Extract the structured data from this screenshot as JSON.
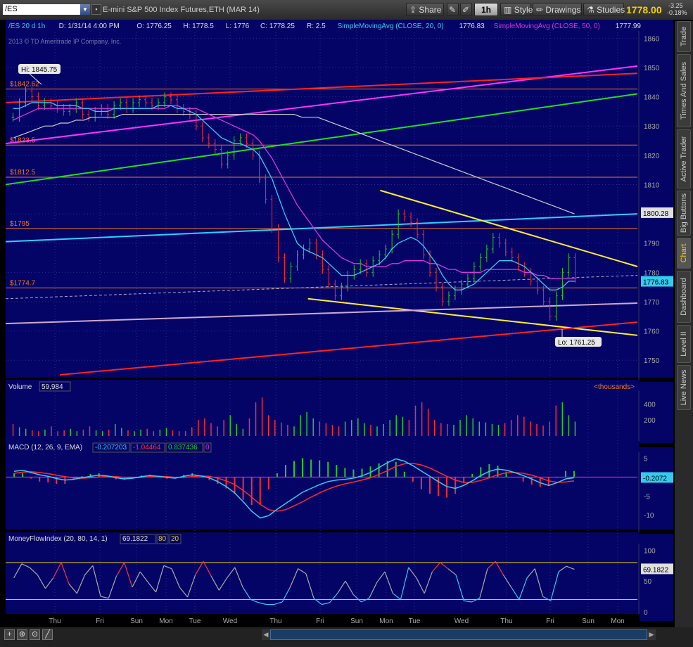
{
  "toolbar": {
    "symbol": "/ES",
    "instrument_desc": "E-mini S&P 500 Index Futures,ETH (MAR 14)",
    "share": "Share",
    "timeframe": "1h",
    "style": "Style",
    "drawings": "Drawings",
    "studies": "Studies",
    "last_price": "1778.00",
    "change_abs": "-3.25",
    "change_pct": "-0.18%"
  },
  "side_tabs": [
    "Trade",
    "Times And Sales",
    "Active Trader",
    "Big Buttons",
    "Chart",
    "Dashboard",
    "Level II",
    "Live News"
  ],
  "active_side_tab": "Chart",
  "colors": {
    "background": "#040466",
    "bull_bar": "#22cc22",
    "bear_bar": "#ff2a2a",
    "sma20": "#33ccee",
    "sma50": "#dd33dd",
    "sma200": "#cccccc",
    "trend_magenta": "#ff33ff",
    "trend_red": "#ff2222",
    "trend_green": "#22dd22",
    "trend_cyan": "#33ccff",
    "trend_yellow": "#ffee33",
    "trend_lavender": "#ccaacc",
    "level_orange": "#ee7722",
    "macd_value": "#33ccee",
    "macd_avg": "#ff2a2a",
    "mfi_line": "#aaaaaa",
    "mfi_band": "#ddcc22"
  },
  "chart_data": [
    {
      "panel": "price",
      "type": "line",
      "header": {
        "symbol_period": "/ES 20 d 1h",
        "date": "D: 1/31/14 4:00 PM",
        "open": "O: 1776.25",
        "high": "H: 1778.5",
        "low": "L: 1776",
        "close": "C: 1778.25",
        "range": "R: 2.5",
        "sma20_label": "SimpleMovingAvg (CLOSE, 20, 0)",
        "sma20_value": "1776.83",
        "sma50_label": "SimpleMovingAvg (CLOSE, 50, 0)",
        "sma50_value": "1777.99"
      },
      "watermark": "2013 © TD Ameritrade IP Company, Inc.",
      "ylim": [
        1745,
        1862
      ],
      "yticks": [
        1750,
        1760,
        1770,
        1780,
        1790,
        1800,
        1810,
        1820,
        1830,
        1840,
        1850,
        1860
      ],
      "xlim": [
        0,
        14
      ],
      "xticks": [
        {
          "x": 1.0,
          "label": "Thu"
        },
        {
          "x": 2.0,
          "label": "Fri"
        },
        {
          "x": 3.0,
          "label": "Sun"
        },
        {
          "x": 4.0,
          "label": "Mon"
        },
        {
          "x": 5.0,
          "label": "Tue"
        },
        {
          "x": 6.0,
          "label": "Wed"
        },
        {
          "x": 7.0,
          "label": "Thu"
        },
        {
          "x": 8.0,
          "label": "Fri"
        },
        {
          "x": 9.0,
          "label": "Sun"
        },
        {
          "x": 10.0,
          "label": "Mon"
        },
        {
          "x": 11.0,
          "label": "Tue"
        },
        {
          "x": 12.0,
          "label": "Wed"
        },
        {
          "x": 13.0,
          "label": "Thu"
        },
        {
          "x": 14.0,
          "label": "Fri"
        }
      ],
      "xtick_labels_display": [
        "Thu",
        "Fri",
        "Sun",
        "Mon",
        "Tue",
        "Wed",
        "Thu",
        "Fri",
        "Sun",
        "Mon",
        "Tue",
        "Wed",
        "Thu",
        "Fri",
        "Sun",
        "Mon"
      ],
      "close_series": [
        1833,
        1838,
        1842,
        1840,
        1837,
        1838,
        1837,
        1836,
        1835,
        1836,
        1838,
        1834,
        1833,
        1835,
        1836,
        1834,
        1837,
        1838,
        1836,
        1838,
        1839,
        1838,
        1837,
        1838,
        1840,
        1839,
        1836,
        1835,
        1834,
        1830,
        1826,
        1824,
        1822,
        1817,
        1820,
        1825,
        1826,
        1824,
        1820,
        1812,
        1805,
        1795,
        1785,
        1778,
        1782,
        1786,
        1788,
        1790,
        1786,
        1781,
        1776,
        1772,
        1775,
        1779,
        1781,
        1783,
        1780,
        1784,
        1786,
        1788,
        1793,
        1800,
        1799,
        1797,
        1793,
        1786,
        1780,
        1775,
        1770,
        1772,
        1774,
        1776,
        1778,
        1782,
        1785,
        1788,
        1792,
        1790,
        1787,
        1785,
        1782,
        1780,
        1777,
        1774,
        1770,
        1765,
        1772,
        1780,
        1785,
        1778
      ],
      "sma20_series": [
        1836,
        1836,
        1837,
        1838,
        1838,
        1838,
        1838,
        1837,
        1837,
        1837,
        1837,
        1836,
        1836,
        1835,
        1835,
        1835,
        1836,
        1836,
        1836,
        1836,
        1836,
        1836,
        1836,
        1837,
        1837,
        1837,
        1836,
        1836,
        1835,
        1834,
        1832,
        1830,
        1828,
        1826,
        1825,
        1824,
        1824,
        1823,
        1822,
        1820,
        1816,
        1812,
        1806,
        1800,
        1795,
        1790,
        1788,
        1787,
        1786,
        1785,
        1783,
        1781,
        1779,
        1779,
        1779,
        1780,
        1781,
        1782,
        1783,
        1785,
        1788,
        1790,
        1791,
        1792,
        1791,
        1789,
        1786,
        1783,
        1779,
        1776,
        1774,
        1774,
        1775,
        1776,
        1778,
        1780,
        1782,
        1784,
        1784,
        1784,
        1783,
        1782,
        1780,
        1778,
        1776,
        1774,
        1774,
        1775,
        1777,
        1777
      ],
      "sma50_series": [
        1832,
        1833,
        1834,
        1835,
        1836,
        1836,
        1836,
        1836,
        1836,
        1836,
        1836,
        1836,
        1836,
        1836,
        1836,
        1836,
        1836,
        1836,
        1836,
        1836,
        1836,
        1836,
        1836,
        1836,
        1836,
        1837,
        1837,
        1836,
        1836,
        1836,
        1835,
        1834,
        1833,
        1832,
        1831,
        1830,
        1829,
        1828,
        1827,
        1825,
        1822,
        1819,
        1815,
        1811,
        1807,
        1803,
        1800,
        1797,
        1794,
        1791,
        1789,
        1787,
        1785,
        1784,
        1783,
        1783,
        1782,
        1782,
        1782,
        1782,
        1783,
        1783,
        1784,
        1784,
        1784,
        1784,
        1783,
        1783,
        1782,
        1781,
        1781,
        1780,
        1780,
        1780,
        1780,
        1781,
        1781,
        1781,
        1781,
        1781,
        1781,
        1780,
        1780,
        1779,
        1779,
        1778,
        1778,
        1778,
        1778,
        1778
      ],
      "sma200_series": [
        1826,
        1827,
        1828,
        1829,
        1830,
        1830,
        1831,
        1831,
        1832,
        1832,
        1833,
        1833,
        1833,
        1833,
        1834,
        1834,
        1834,
        1834,
        1834,
        1834,
        1834,
        1834,
        1834,
        1834,
        1834,
        1834,
        1834,
        1834,
        1834,
        1834,
        1834,
        1834,
        1834,
        1834,
        1834,
        1834,
        1834,
        1833,
        1833,
        1833,
        1832,
        1831,
        1830,
        1829,
        1828,
        1827,
        1826,
        1825,
        1824,
        1823,
        1822,
        1821,
        1820,
        1819,
        1818,
        1817,
        1816,
        1815,
        1814,
        1813,
        1812,
        1811,
        1810,
        1809,
        1808,
        1807,
        1806,
        1805,
        1804,
        1803,
        1802,
        1801,
        1800
      ],
      "horizontal_levels": [
        {
          "value": 1842.62,
          "label": "$1842.62"
        },
        {
          "value": 1823.5,
          "label": "$1823.5"
        },
        {
          "value": 1812.5,
          "label": "$1812.5"
        },
        {
          "value": 1795,
          "label": "$1795"
        },
        {
          "value": 1774.7,
          "label": "$1774.7"
        }
      ],
      "trendlines": [
        {
          "color": "trend_magenta",
          "from": [
            0,
            1824
          ],
          "to": [
            14,
            1850.5
          ]
        },
        {
          "color": "trend_red",
          "from": [
            0,
            1838
          ],
          "to": [
            14,
            1848
          ]
        },
        {
          "color": "trend_green",
          "from": [
            0,
            1810
          ],
          "to": [
            14,
            1841
          ]
        },
        {
          "color": "trend_cyan",
          "from": [
            0,
            1790.5
          ],
          "to": [
            14,
            1800
          ]
        },
        {
          "color": "trend_yellow",
          "from": [
            8.3,
            1808
          ],
          "to": [
            14,
            1782
          ]
        },
        {
          "color": "trend_yellow",
          "from": [
            6.7,
            1771
          ],
          "to": [
            14,
            1758.5
          ]
        },
        {
          "color": "trend_lavender",
          "from": [
            0,
            1762.5
          ],
          "to": [
            14,
            1769.5
          ]
        },
        {
          "color": "trend_red",
          "from": [
            1.2,
            1745
          ],
          "to": [
            14,
            1763
          ]
        }
      ],
      "dashed_close_line": {
        "from": [
          0,
          1771
        ],
        "to": [
          14,
          1779
        ]
      },
      "hi_label": "Hi: 1845.75",
      "lo_label": "Lo: 1761.25",
      "price_label_1800": "1800.28",
      "price_label_current": "1776.83"
    },
    {
      "panel": "volume",
      "type": "bar",
      "title": "Volume",
      "value": "59,984",
      "units": "<thousands>",
      "ylim": [
        0,
        500
      ],
      "yticks": [
        200,
        400
      ],
      "values": [
        150,
        110,
        90,
        70,
        60,
        80,
        120,
        60,
        70,
        90,
        60,
        80,
        120,
        70,
        60,
        80,
        150,
        100,
        70,
        60,
        80,
        90,
        60,
        80,
        100,
        70,
        60,
        60,
        110,
        200,
        220,
        160,
        120,
        200,
        260,
        150,
        90,
        220,
        420,
        480,
        260,
        200,
        170,
        140,
        120,
        260,
        300,
        220,
        180,
        160,
        140,
        120,
        180,
        200,
        220,
        160,
        140,
        120,
        150,
        200,
        260,
        240,
        200,
        380,
        420,
        340,
        200,
        160,
        150,
        140,
        200,
        260,
        220,
        180,
        170,
        150,
        140,
        160,
        200,
        260,
        240,
        180,
        150,
        130,
        180,
        380,
        420,
        260,
        180
      ]
    },
    {
      "panel": "macd",
      "type": "line",
      "title": "MACD (12, 26, 9, EMA)",
      "value": "-0.207203",
      "avg": "-1.04464",
      "diff": "0.837436",
      "zero": "0",
      "ylim": [
        -12,
        6
      ],
      "yticks": [
        5,
        -5,
        -10
      ],
      "current_label": "-0.2072",
      "value_series": [
        1.5,
        1.8,
        1.2,
        0.6,
        0.2,
        -0.4,
        -0.8,
        -0.6,
        -0.2,
        0.2,
        0.5,
        0.3,
        -0.2,
        -0.5,
        -0.3,
        0.1,
        0.4,
        0.2,
        -0.1,
        -0.3,
        0.2,
        0.6,
        0.3,
        -0.2,
        -1.2,
        -2.5,
        -4.2,
        -6.5,
        -9.0,
        -10.8,
        -10.2,
        -8.5,
        -7.0,
        -5.5,
        -4.0,
        -3.0,
        -2.0,
        -1.2,
        -0.8,
        -0.6,
        -0.3,
        0.3,
        1.2,
        2.5,
        3.8,
        4.8,
        4.2,
        3.0,
        1.6,
        0.2,
        -1.2,
        -2.5,
        -3.0,
        -2.2,
        -1.0,
        0.4,
        1.5,
        2.1,
        1.8,
        1.2,
        0.4,
        -0.5,
        -1.5,
        -2.2,
        -1.5,
        -0.5,
        -0.2
      ],
      "avg_series": [
        1.0,
        1.3,
        1.4,
        1.2,
        0.9,
        0.5,
        0.1,
        -0.2,
        -0.3,
        -0.2,
        0.0,
        0.2,
        0.1,
        -0.1,
        -0.2,
        -0.1,
        0.1,
        0.2,
        0.1,
        -0.1,
        -0.1,
        0.1,
        0.3,
        0.2,
        -0.3,
        -1.0,
        -2.0,
        -3.5,
        -5.3,
        -7.2,
        -8.6,
        -9.0,
        -8.6,
        -7.6,
        -6.5,
        -5.3,
        -4.2,
        -3.2,
        -2.4,
        -1.8,
        -1.3,
        -0.8,
        -0.2,
        0.7,
        1.7,
        2.8,
        3.5,
        3.6,
        3.2,
        2.4,
        1.3,
        0.2,
        -0.8,
        -1.4,
        -1.4,
        -0.9,
        -0.2,
        0.6,
        1.1,
        1.2,
        1.0,
        0.5,
        -0.2,
        -1.0,
        -1.4,
        -1.3,
        -1.0
      ]
    },
    {
      "panel": "mfi",
      "type": "line",
      "title": "MoneyFlowIndex (20, 80, 14, 1)",
      "value": "69.1822",
      "overbought": "80",
      "oversold": "20",
      "ylim": [
        0,
        105
      ],
      "yticks": [
        100,
        50,
        0
      ],
      "current_label": "69.1822",
      "series": [
        55,
        78,
        72,
        60,
        38,
        55,
        80,
        45,
        30,
        60,
        75,
        25,
        22,
        58,
        80,
        40,
        65,
        48,
        32,
        75,
        70,
        40,
        24,
        60,
        82,
        58,
        35,
        55,
        72,
        40,
        20,
        15,
        12,
        12,
        16,
        40,
        70,
        62,
        22,
        12,
        15,
        30,
        50,
        28,
        16,
        22,
        48,
        65,
        30,
        20,
        72,
        55,
        30,
        65,
        80,
        70,
        60,
        18,
        16,
        22,
        70,
        82,
        60,
        40,
        20,
        55,
        70,
        25,
        18,
        65,
        74,
        69
      ]
    }
  ],
  "bottom_bar": {
    "icons": [
      "zoom-in",
      "zoom-out",
      "zoom-fit",
      "drawing-tool"
    ]
  }
}
